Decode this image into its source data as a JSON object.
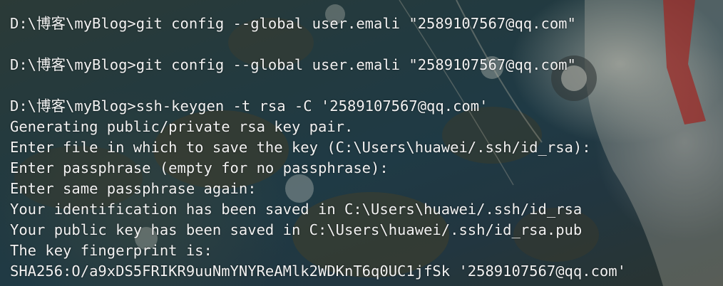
{
  "terminal": {
    "lines": [
      "D:\\博客\\myBlog>git config --global user.emali \"2589107567@qq.com\"",
      "",
      "D:\\博客\\myBlog>git config --global user.emali \"2589107567@qq.com\"",
      "",
      "D:\\博客\\myBlog>ssh-keygen -t rsa -C '2589107567@qq.com'",
      "Generating public/private rsa key pair.",
      "Enter file in which to save the key (C:\\Users\\huawei/.ssh/id_rsa):",
      "Enter passphrase (empty for no passphrase):",
      "Enter same passphrase again:",
      "Your identification has been saved in C:\\Users\\huawei/.ssh/id_rsa",
      "Your public key has been saved in C:\\Users\\huawei/.ssh/id_rsa.pub",
      "The key fingerprint is:",
      "SHA256:O/a9xDS5FRIKR9uuNmYNYReAMlk2WDKnT6q0UC1jfSk '2589107567@qq.com'"
    ]
  },
  "colors": {
    "text": "#f2f2f2",
    "background": "#223a40"
  }
}
